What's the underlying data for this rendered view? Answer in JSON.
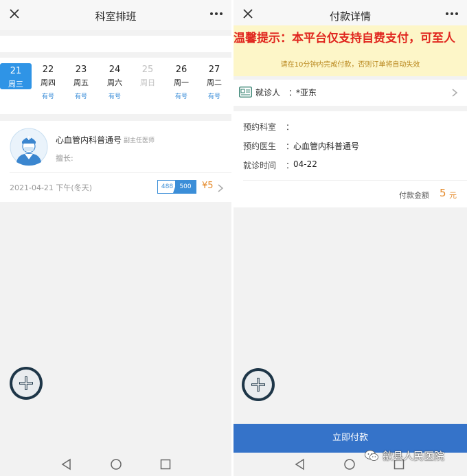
{
  "left": {
    "title": "科室排班",
    "days": [
      {
        "num": "21",
        "wk": "周三",
        "status": ""
      },
      {
        "num": "22",
        "wk": "周四",
        "status": "有号"
      },
      {
        "num": "23",
        "wk": "周五",
        "status": "有号"
      },
      {
        "num": "24",
        "wk": "周六",
        "status": "有号"
      },
      {
        "num": "25",
        "wk": "周日",
        "status": ""
      },
      {
        "num": "26",
        "wk": "周一",
        "status": "有号"
      },
      {
        "num": "27",
        "wk": "周二",
        "status": "有号"
      }
    ],
    "selected_day_index": 0,
    "disabled_day_index": 4,
    "doctor": {
      "name": "心血管内科普通号",
      "rank": "副主任医师",
      "good_at": "擅长:",
      "schedule": "2021-04-21 下午(冬天)",
      "quota_left": "488",
      "quota_right": "500",
      "price": "¥5"
    }
  },
  "right": {
    "title": "付款详情",
    "notice_title": "温馨提示：本平台仅支持自费支付，可至人",
    "notice_sub": "请在10分钟内完成付款，否则订单将自动失效",
    "patient_label": "就诊人",
    "patient_colon": "：",
    "patient_name": "*亚东",
    "rows": [
      {
        "label": "预约科室",
        "colon": "：",
        "value": ""
      },
      {
        "label": "预约医生",
        "colon": "：",
        "value": "心血管内科普通号"
      },
      {
        "label": "就诊时间",
        "colon": "：",
        "value": "04-22"
      }
    ],
    "pay_label": "付款金额",
    "pay_amount": "5",
    "pay_unit": "元",
    "pay_button": "立即付款",
    "watermark": "歙县人民医院"
  },
  "icons": {
    "close": "close-icon",
    "more": "more-icon",
    "add": "plus-icon",
    "back": "nav-back-icon",
    "home": "nav-home-icon",
    "recent": "nav-recent-icon"
  },
  "colors": {
    "accent": "#2f94e6",
    "price": "#e58a2a",
    "alert": "#e0261e",
    "notice_bg": "#fdf6c8",
    "button": "#3573c9"
  }
}
